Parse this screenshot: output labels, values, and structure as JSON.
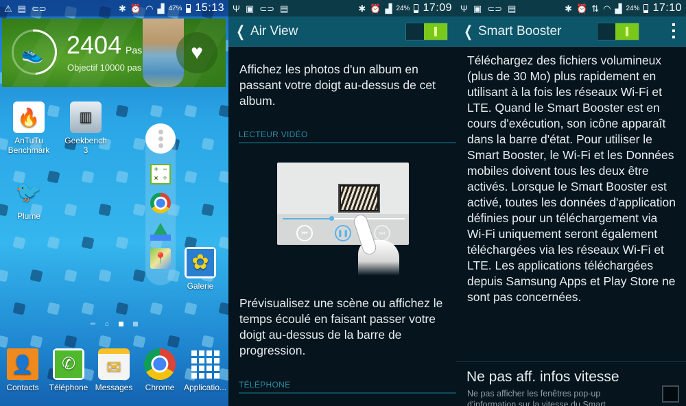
{
  "panels": {
    "home": {
      "statusbar": {
        "left_icons": [
          "warning-icon",
          "sim-card-icon",
          "notification-icon"
        ],
        "right_icons": [
          "bluetooth-icon",
          "alarm-icon",
          "wifi-icon",
          "signal-icon"
        ],
        "battery_percent": "47%",
        "time": "15:13"
      },
      "health_widget": {
        "steps": "2404",
        "steps_unit": "Pas",
        "goal": "Objectif 10000 pas",
        "progress_fraction": 0.24
      },
      "apps": [
        {
          "label": "AnTuTu Benchmark",
          "icon": "antutu-icon"
        },
        {
          "label": "Geekbench 3",
          "icon": "geekbench-icon"
        },
        {
          "label": "Plume",
          "icon": "plume-icon"
        },
        {
          "label": "Galerie",
          "icon": "gallery-icon"
        }
      ],
      "toolbox": {
        "items": [
          "calculator-icon",
          "chrome-icon",
          "google-drive-icon",
          "google-maps-icon"
        ]
      },
      "page_indicator": {
        "pages": 2,
        "active": 1
      },
      "dock": [
        {
          "label": "Contacts",
          "icon": "contacts-icon"
        },
        {
          "label": "Téléphone",
          "icon": "phone-icon"
        },
        {
          "label": "Messages",
          "icon": "messages-icon"
        },
        {
          "label": "Chrome",
          "icon": "chrome-icon"
        },
        {
          "label": "Applicatio...",
          "icon": "apps-grid-icon"
        }
      ]
    },
    "air_view": {
      "statusbar": {
        "left_icons": [
          "usb-icon",
          "image-icon",
          "notification-icon",
          "sim-card-icon"
        ],
        "right_icons": [
          "bluetooth-icon",
          "alarm-icon",
          "signal-icon"
        ],
        "battery_percent": "24%",
        "time": "17:09"
      },
      "title": "Air View",
      "toggle_on": true,
      "intro": "Affichez les photos d'un album en passant votre doigt au-dessus de cet album.",
      "section_video": "LECTEUR VIDÉO",
      "video_progress_fraction": 0.4,
      "video_desc": "Prévisualisez une scène ou affichez le temps écoulé en faisant passer votre doigt au-dessus de la barre de progression.",
      "section_phone": "TÉLÉPHONE"
    },
    "smart_booster": {
      "statusbar": {
        "left_icons": [
          "usb-icon",
          "image-icon",
          "notification-icon",
          "sim-card-icon"
        ],
        "right_icons": [
          "bluetooth-icon",
          "alarm-icon",
          "data-transfer-icon",
          "wifi-icon",
          "signal-icon"
        ],
        "battery_percent": "24%",
        "time": "17:10"
      },
      "title": "Smart Booster",
      "toggle_on": true,
      "description": "Téléchargez des fichiers volumineux (plus de 30 Mo) plus rapidement en utilisant à la fois les réseaux Wi-Fi et LTE. Quand le Smart Booster est en cours d'exécution, son icône apparaît dans la barre d'état. Pour utiliser le Smart Booster, le Wi-Fi et les Données mobiles doivent tous les deux être activés. Lorsque le Smart Booster est activé, toutes les données d'application définies pour un téléchargement via Wi-Fi uniquement seront également téléchargées via les réseaux Wi-Fi et LTE. Les applications téléchargées depuis Samsung Apps et Play Store ne sont pas concernées.",
      "option": {
        "title": "Ne pas aff. infos vitesse",
        "subtitle": "Ne pas afficher les fenêtres pop-up d'information sur la vitesse du Smart",
        "checked": false
      }
    }
  },
  "colors": {
    "toggle_on": "#7ac81a",
    "actionbar": "#0d5568",
    "section_header": "#2e8aa3",
    "settings_bg": "#05141d"
  }
}
